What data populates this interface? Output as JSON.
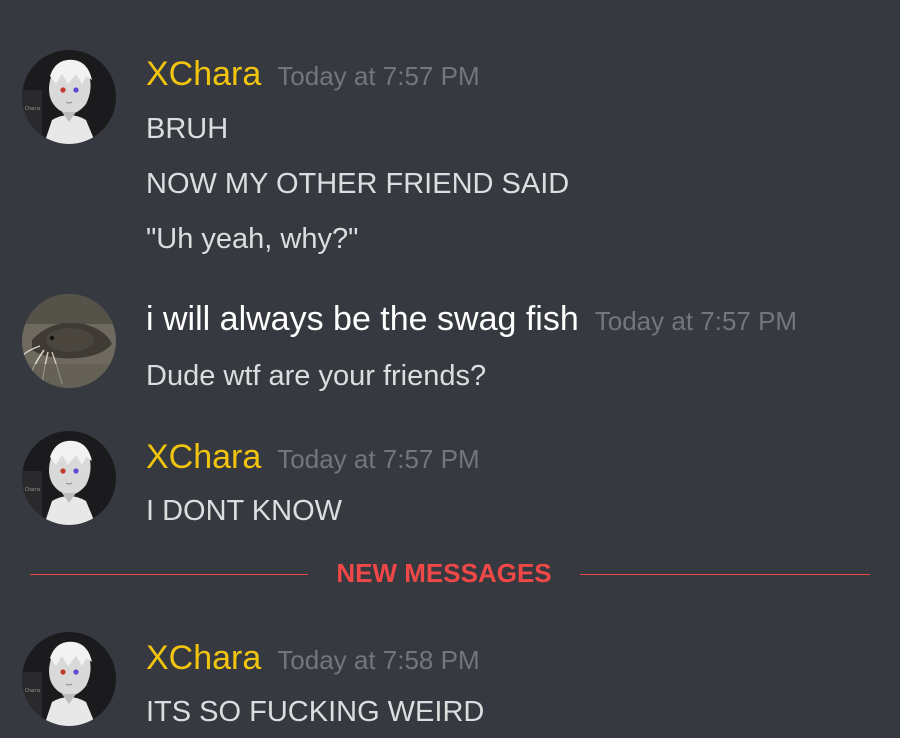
{
  "messages": [
    {
      "username": "XChara",
      "timestamp": "Today at 7:57 PM",
      "avatar_icon": "chara-avatar",
      "lines": [
        "BRUH",
        "NOW MY OTHER FRIEND SAID",
        "\"Uh yeah, why?\""
      ]
    },
    {
      "username": "i will always be the swag fish",
      "timestamp": "Today at 7:57 PM",
      "avatar_icon": "catfish-avatar",
      "lines": [
        "Dude wtf are your friends?"
      ]
    },
    {
      "username": "XChara",
      "timestamp": "Today at 7:57 PM",
      "avatar_icon": "chara-avatar",
      "lines": [
        "I DONT KNOW"
      ]
    },
    {
      "username": "XChara",
      "timestamp": "Today at 7:58 PM",
      "avatar_icon": "chara-avatar",
      "lines": [
        "ITS SO FUCKING WEIRD"
      ]
    }
  ],
  "divider": {
    "label": "NEW MESSAGES"
  },
  "colors": {
    "background": "#36393f",
    "username_xchara": "#f1c40f",
    "username_fish": "#ffffff",
    "timestamp": "#72767d",
    "message_text": "#dcddde",
    "new_messages": "#f04747"
  }
}
